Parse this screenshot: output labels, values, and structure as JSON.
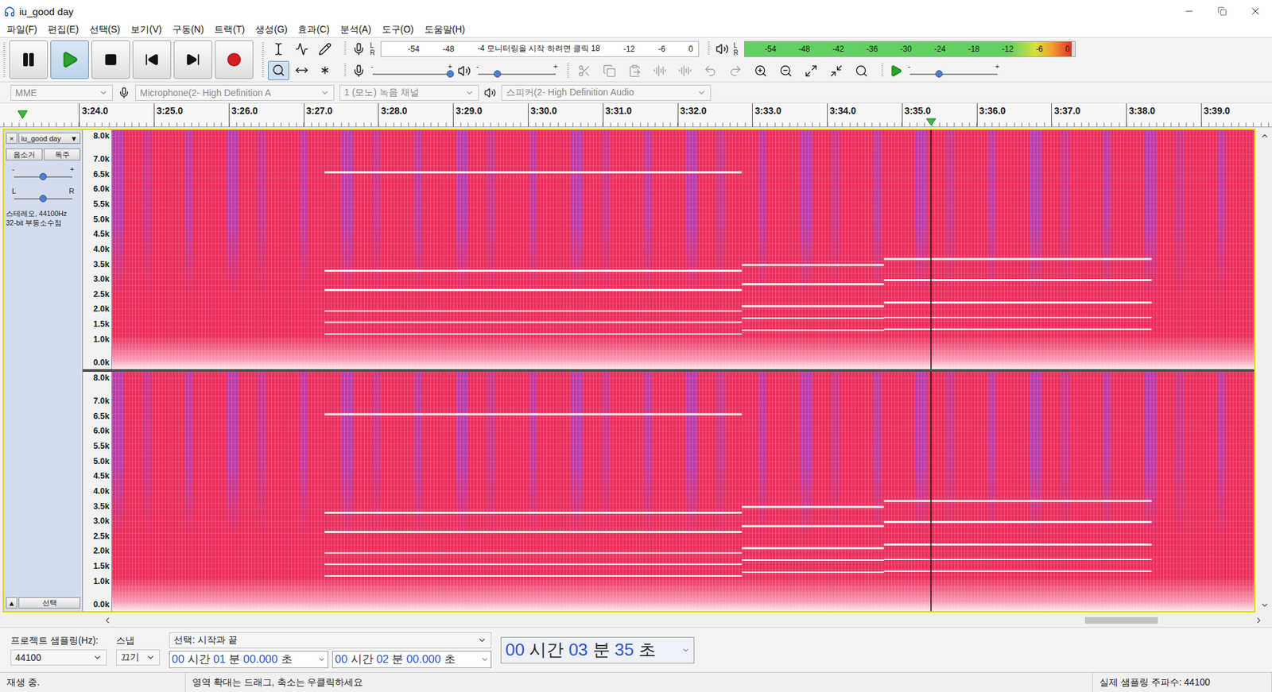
{
  "window": {
    "title": "iu_good day"
  },
  "menu": [
    "파일(F)",
    "편집(E)",
    "선택(S)",
    "보기(V)",
    "구동(N)",
    "트랙(T)",
    "생성(G)",
    "효과(C)",
    "분석(A)",
    "도구(O)",
    "도움말(H)"
  ],
  "transport": [
    {
      "kind": "pause",
      "selected": false
    },
    {
      "kind": "play",
      "selected": true
    },
    {
      "kind": "stop",
      "selected": false
    },
    {
      "kind": "skip-start",
      "selected": false
    },
    {
      "kind": "skip-end",
      "selected": false
    },
    {
      "kind": "record",
      "selected": false
    }
  ],
  "tools": [
    {
      "kind": "select",
      "selected": false
    },
    {
      "kind": "envelope",
      "selected": false
    },
    {
      "kind": "draw",
      "selected": false
    },
    {
      "kind": "zoom",
      "selected": true
    },
    {
      "kind": "timeshift",
      "selected": false
    },
    {
      "kind": "multi",
      "selected": false
    }
  ],
  "record_meter": {
    "left": "L",
    "right": "R",
    "scale": [
      "-54",
      "-48",
      "-4 모니터링을 시작 하려면 클릭 18",
      "-12",
      "-6",
      "0"
    ]
  },
  "playback_meter": {
    "left": "L",
    "right": "R",
    "level": 0.99,
    "scale": [
      "-54",
      "-48",
      "-42",
      "-36",
      "-30",
      "-24",
      "-18",
      "-12",
      "-6",
      "0"
    ]
  },
  "mixer": {
    "record_volume": {
      "minus": "-",
      "plus": "+",
      "level": 1.0
    },
    "playback_volume": {
      "minus": "-",
      "plus": "+",
      "level": 0.25
    }
  },
  "edit_tools": [
    {
      "kind": "cut",
      "disabled": true
    },
    {
      "kind": "copy",
      "disabled": true
    },
    {
      "kind": "paste",
      "disabled": true
    },
    {
      "kind": "trim",
      "disabled": true
    },
    {
      "kind": "silence",
      "disabled": true
    },
    {
      "kind": "undo",
      "disabled": true
    },
    {
      "kind": "redo",
      "disabled": true
    },
    {
      "kind": "zoom-in",
      "disabled": false
    },
    {
      "kind": "zoom-out",
      "disabled": false
    },
    {
      "kind": "fit-selection",
      "disabled": false
    },
    {
      "kind": "fit-project",
      "disabled": false
    },
    {
      "kind": "zoom-toggle",
      "disabled": false
    }
  ],
  "play_at_speed": {
    "minus": "-",
    "plus": "+",
    "level": 0.33
  },
  "devices": [
    {
      "kind": "host",
      "value": "MME",
      "disabled": true
    },
    {
      "kind": "input",
      "value": "Microphone(2- High Definition A",
      "disabled": true
    },
    {
      "kind": "channels",
      "value": "1 (모노) 녹음 채널",
      "disabled": true
    },
    {
      "kind": "output",
      "value": "스피커(2- High Definition Audio",
      "disabled": true
    }
  ],
  "ruler": {
    "ticks": [
      "3:24.0",
      "3:25.0",
      "3:26.0",
      "3:27.0",
      "3:28.0",
      "3:29.0",
      "3:30.0",
      "3:31.0",
      "3:32.0",
      "3:33.0",
      "3:34.0",
      "3:35.0",
      "3:36.0",
      "3:37.0",
      "3:38.0",
      "3:39.0"
    ]
  },
  "track": {
    "close": "×",
    "name": "iu_good day",
    "menu_arrow": "▼",
    "buttons": [
      "음소거",
      "독주"
    ],
    "gain": {
      "minus": "-",
      "plus": "+",
      "level": 0.5
    },
    "pan": {
      "minus": "L",
      "plus": "R",
      "level": 0.5
    },
    "info": [
      "스테레오, 44100Hz",
      "32-bit 부동소수점"
    ],
    "collapse": "▲",
    "select_button": "선택"
  },
  "spectrogram": {
    "start_s": 204.44,
    "end_s": 219.71,
    "playhead_s": 215.39,
    "channels": 2,
    "scale": [
      "8.0k",
      "7.0k",
      "6.5k",
      "6.0k",
      "5.5k",
      "5.0k",
      "4.5k",
      "4.0k",
      "3.5k",
      "3.0k",
      "2.5k",
      "2.0k",
      "1.5k",
      "1.0k",
      "0.0k"
    ],
    "harmonics": [
      {
        "start": 207.28,
        "end": 212.86,
        "khz": [
          6.56,
          3.28,
          2.64,
          1.94,
          1.56,
          1.17
        ]
      },
      {
        "start": 212.86,
        "end": 214.76,
        "khz": [
          3.47,
          2.83,
          2.1,
          1.7,
          1.3
        ]
      },
      {
        "start": 214.76,
        "end": 218.34,
        "khz": [
          3.67,
          2.97,
          2.22,
          1.72,
          1.33
        ]
      }
    ]
  },
  "hscroll": {
    "thumb_start": 0.852,
    "thumb_size": 0.064
  },
  "selection_toolbar": {
    "rate_label": "프로젝트 샘플링(Hz):",
    "rate": "44100",
    "snap_label": "스냅",
    "snap": "끄기",
    "mode": "선택: 시작과 끝",
    "start": "00 시간 01 분 00.000 초",
    "end": "00 시간 02 분 00.000 초",
    "position": "00 시간 03 분 35 초"
  },
  "status_bar": {
    "state": "재생 중.",
    "hint": "영역 확대는 드래그, 축소는 우클릭하세요",
    "rate": "실제 샘플링 주파수: 44100"
  }
}
